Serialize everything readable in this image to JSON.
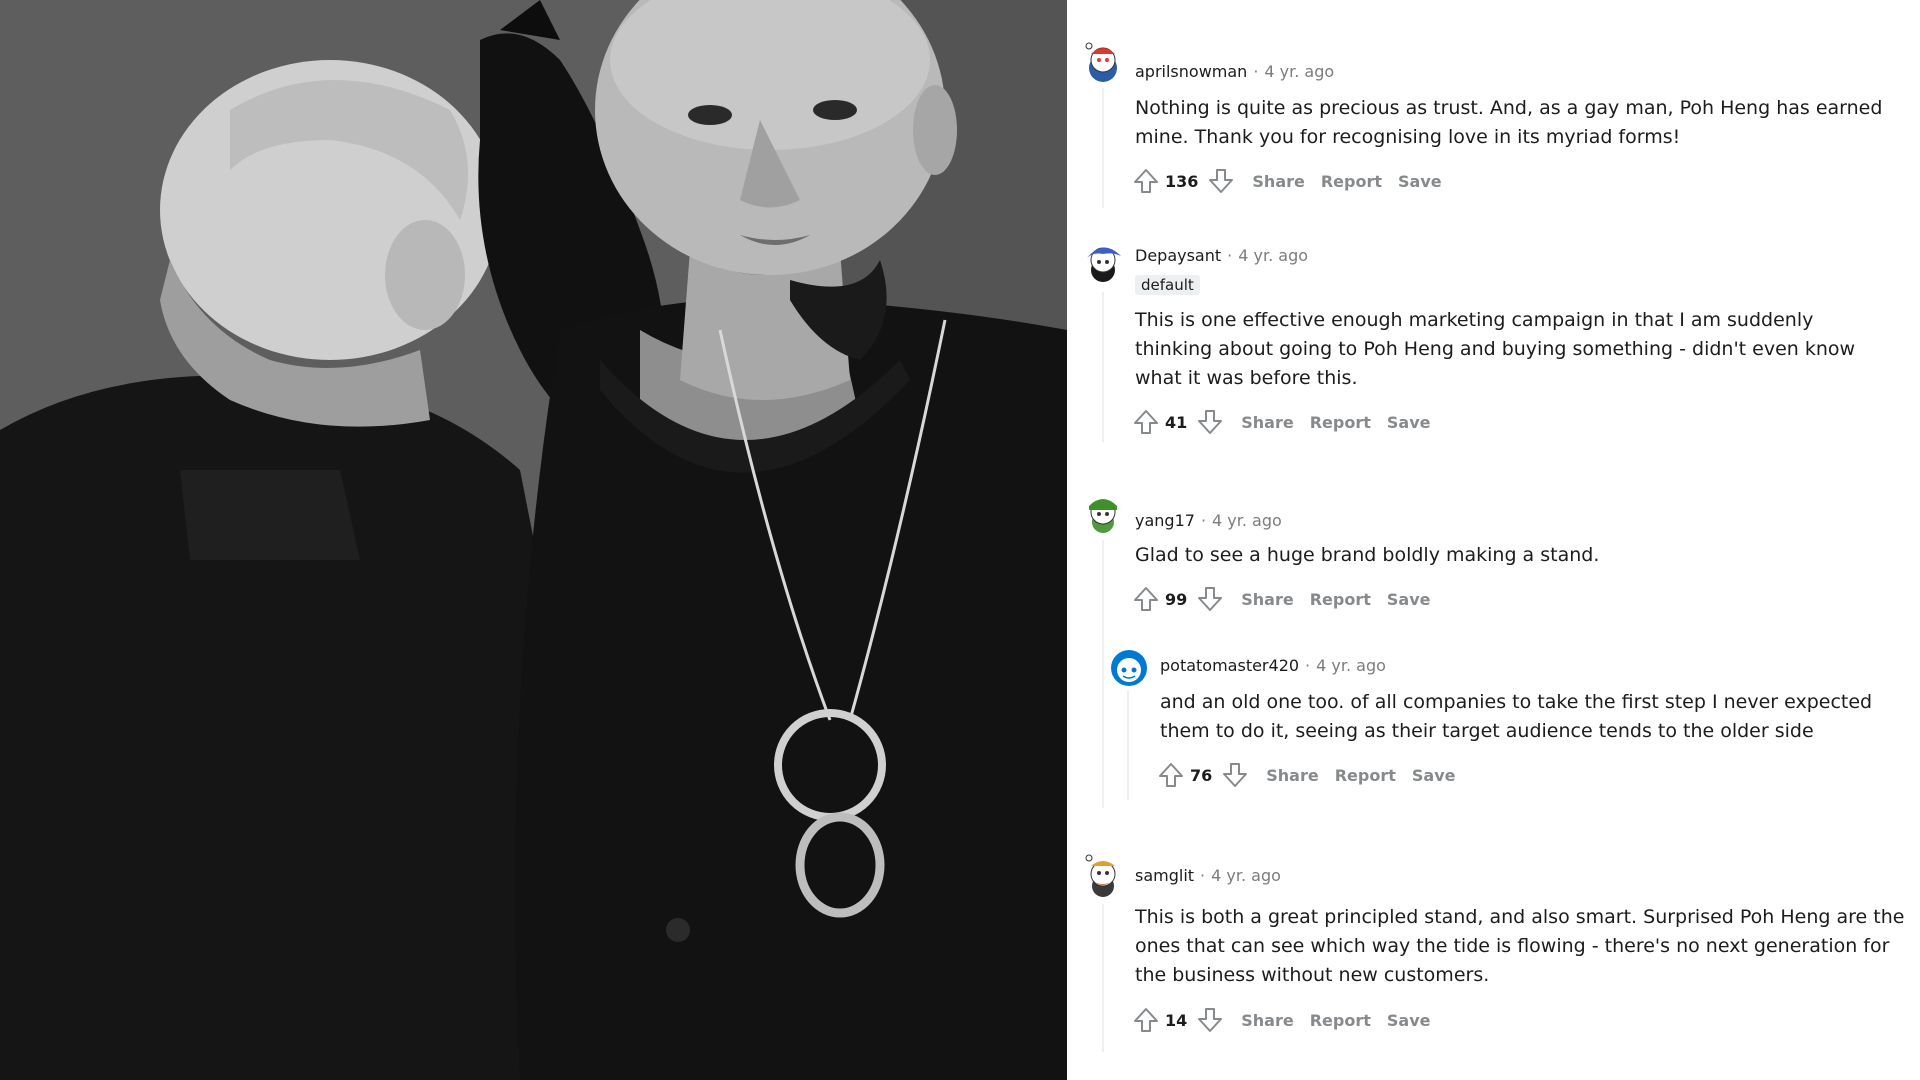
{
  "comments": [
    {
      "author": "aprilsnowman",
      "age": "4 yr. ago",
      "flair": "",
      "body": "Nothing is quite as precious as trust. And, as a gay man, Poh Heng has earned mine. Thank you for recognising love in its myriad forms!",
      "score": "136",
      "actions": [
        "Share",
        "Report",
        "Save"
      ],
      "avatar": "snoo-avatar-red-cap"
    },
    {
      "author": "Depaysant",
      "age": "4 yr. ago",
      "flair": "default",
      "body": "This is one effective enough marketing campaign in that I am suddenly thinking about going to Poh Heng and buying something - didn't even know what it was before this.",
      "score": "41",
      "actions": [
        "Share",
        "Report",
        "Save"
      ],
      "avatar": "snoo-avatar-blue-hat"
    },
    {
      "author": "yang17",
      "age": "4 yr. ago",
      "flair": "",
      "body": "Glad to see a huge brand boldly making a stand.",
      "score": "99",
      "actions": [
        "Share",
        "Report",
        "Save"
      ],
      "avatar": "snoo-avatar-green-cap"
    },
    {
      "author": "potatomaster420",
      "age": "4 yr. ago",
      "flair": "",
      "body": "and an old one too. of all companies to take the first step I never expected them to do it, seeing as their target audience tends to the older side",
      "score": "76",
      "actions": [
        "Share",
        "Report",
        "Save"
      ],
      "avatar": "snoo-avatar-blue-default"
    },
    {
      "author": "samglit",
      "age": "4 yr. ago",
      "flair": "",
      "body": "This is both a great principled stand, and also smart. Surprised Poh Heng are the ones that can see which way the tide is flowing - there's no next generation for the business without new customers.",
      "score": "14",
      "actions": [
        "Share",
        "Report",
        "Save"
      ],
      "avatar": "snoo-avatar-orange-beard"
    }
  ],
  "colors": {
    "text": "#1c1c1c",
    "meta": "#7c7c7c",
    "action": "#878a8c",
    "thread_line": "#edeff1",
    "flair_bg": "#edeff1"
  }
}
